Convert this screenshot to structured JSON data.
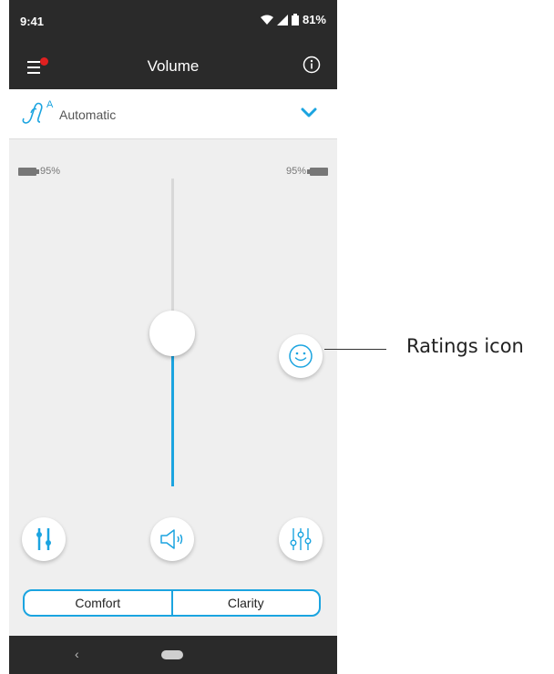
{
  "statusbar": {
    "time": "9:41",
    "battery": "81%",
    "icons": [
      "wifi-icon",
      "signal-icon",
      "battery-icon"
    ]
  },
  "appbar": {
    "title": "Volume",
    "menu_icon": "hamburger-menu-icon",
    "has_notification": true,
    "info_icon": "info-icon"
  },
  "program": {
    "label": "Automatic",
    "superscript": "A",
    "icon": "hearing-aid-icon",
    "chevron": "chevron-down-icon"
  },
  "batteries": {
    "left": "95%",
    "right": "95%"
  },
  "volume": {
    "level": 0.5
  },
  "buttons": {
    "ratings": {
      "icon": "smiley-icon"
    },
    "left": {
      "icon": "equalizer-icon"
    },
    "center": {
      "icon": "speaker-icon"
    },
    "right": {
      "icon": "sliders-icon"
    }
  },
  "segments": [
    "Comfort",
    "Clarity"
  ],
  "navbar": {
    "back": "‹"
  },
  "annotation": {
    "label": "Ratings icon"
  },
  "colors": {
    "accent": "#1ba4e0",
    "bar": "#2a2a2a",
    "notification": "#e02020",
    "background": "#efefef"
  }
}
